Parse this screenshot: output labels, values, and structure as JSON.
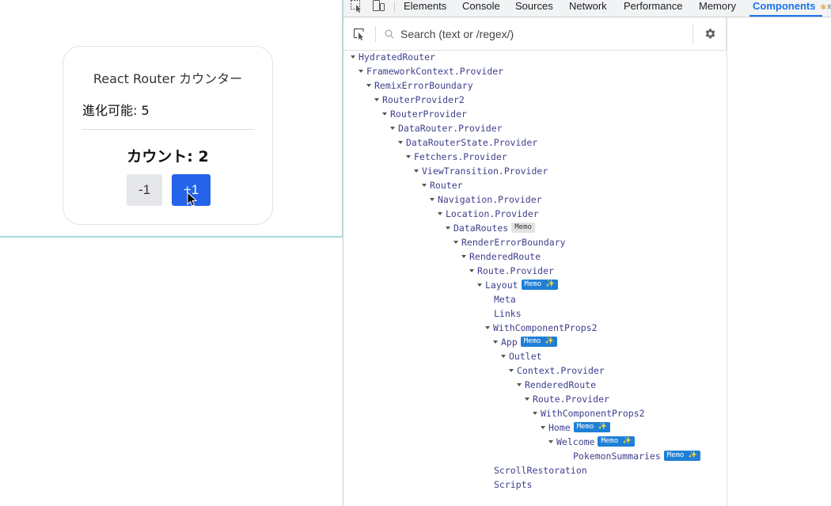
{
  "app": {
    "card_title": "React Router カウンター",
    "evolution_label": "進化可能: 5",
    "count_label": "カウント: 2",
    "decrement_label": "-1",
    "increment_label": "+1"
  },
  "devtools": {
    "tabs": [
      "Elements",
      "Console",
      "Sources",
      "Network",
      "Performance",
      "Memory",
      "Components"
    ],
    "active_tab": "Components",
    "search_placeholder": "Search (text or /regex/)",
    "accent_color": "#1a73e8",
    "tree": [
      {
        "name": "HydratedRouter"
      },
      {
        "name": "FrameworkContext.Provider"
      },
      {
        "name": "RemixErrorBoundary"
      },
      {
        "name": "RouterProvider2"
      },
      {
        "name": "RouterProvider"
      },
      {
        "name": "DataRouter.Provider"
      },
      {
        "name": "DataRouterState.Provider"
      },
      {
        "name": "Fetchers.Provider"
      },
      {
        "name": "ViewTransition.Provider"
      },
      {
        "name": "Router"
      },
      {
        "name": "Navigation.Provider"
      },
      {
        "name": "Location.Provider"
      },
      {
        "name": "DataRoutes",
        "badge": "Memo"
      },
      {
        "name": "RenderErrorBoundary"
      },
      {
        "name": "RenderedRoute"
      },
      {
        "name": "Route.Provider"
      },
      {
        "name": "Layout",
        "badge": "Memo ✨"
      },
      {
        "name": "Meta"
      },
      {
        "name": "Links"
      },
      {
        "name": "WithComponentProps2"
      },
      {
        "name": "App",
        "badge": "Memo ✨"
      },
      {
        "name": "Outlet"
      },
      {
        "name": "Context.Provider"
      },
      {
        "name": "RenderedRoute"
      },
      {
        "name": "Route.Provider"
      },
      {
        "name": "WithComponentProps2"
      },
      {
        "name": "Home",
        "badge": "Memo ✨"
      },
      {
        "name": "Welcome",
        "badge": "Memo ✨"
      },
      {
        "name": "PokemonSummaries",
        "badge": "Memo ✨"
      },
      {
        "name": "ScrollRestoration"
      },
      {
        "name": "Scripts"
      }
    ]
  }
}
